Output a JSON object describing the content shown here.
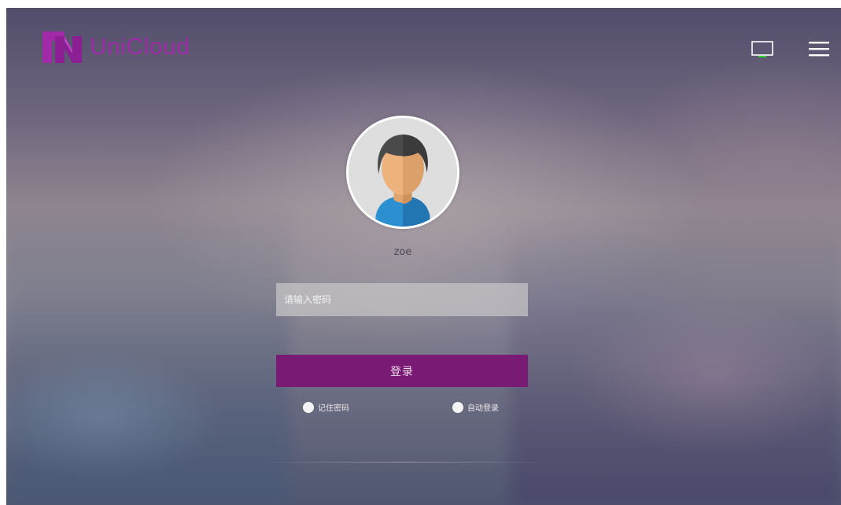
{
  "brand": {
    "name": "UniCloud",
    "color": "#9e2aa6"
  },
  "header": {
    "icons": [
      "monitor-icon",
      "menu-icon"
    ]
  },
  "login": {
    "username": "zoe",
    "password_placeholder": "请输入密码",
    "login_label": "登录",
    "button_color": "#791a74",
    "remember_password_label": "记住密码",
    "auto_login_label": "自动登录"
  }
}
